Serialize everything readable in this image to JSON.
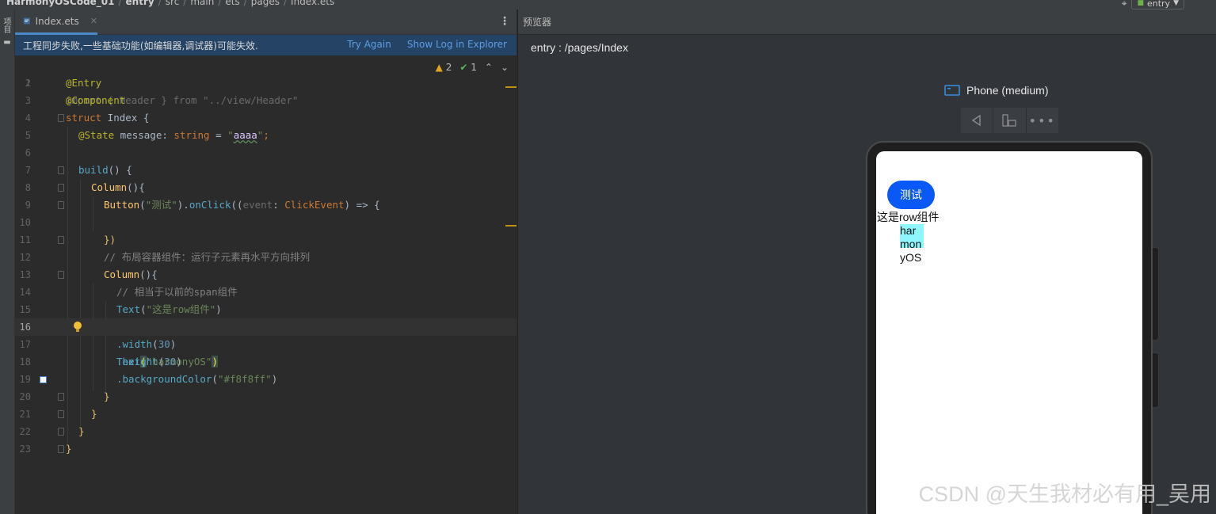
{
  "topbar": {
    "project": "HarmonyOSCode_01",
    "module": "entry",
    "path": [
      "src",
      "main",
      "ets",
      "pages"
    ],
    "file": "Index.ets",
    "run_config": "entry"
  },
  "left_strip": {
    "label": "项目"
  },
  "editor": {
    "tab_label": "Index.ets",
    "notice": {
      "message": "工程同步失败,一些基础功能(如编辑器,调试器)可能失效.",
      "try_again": "Try Again",
      "show_log": "Show Log in Explorer"
    },
    "inspection": {
      "warnings": "2",
      "weak_warnings": "1"
    },
    "current_line": 16,
    "lines": [
      {
        "n": "1"
      },
      {
        "n": "2"
      },
      {
        "n": "3"
      },
      {
        "n": "4"
      },
      {
        "n": "5"
      },
      {
        "n": "6"
      },
      {
        "n": "7"
      },
      {
        "n": "8"
      },
      {
        "n": "9"
      },
      {
        "n": "10"
      },
      {
        "n": "11"
      },
      {
        "n": "12"
      },
      {
        "n": "13"
      },
      {
        "n": "14"
      },
      {
        "n": "15"
      },
      {
        "n": "16"
      },
      {
        "n": "17"
      },
      {
        "n": "18"
      },
      {
        "n": "19"
      },
      {
        "n": "20"
      },
      {
        "n": "21"
      },
      {
        "n": "22"
      },
      {
        "n": "23"
      }
    ],
    "code": {
      "l1": [
        "import",
        " { ",
        "Header",
        " } ",
        "from",
        " \"../view/Header\""
      ],
      "l2": "@Entry",
      "l3": "@Component",
      "l4": [
        "struct",
        " Index {"
      ],
      "l5": [
        "@State",
        " message: ",
        "string",
        " = ",
        "\"",
        "aaaa",
        "\"",
        ";"
      ],
      "l7": [
        "build",
        "() {"
      ],
      "l8": [
        "Column",
        "(){"
      ],
      "l9": [
        "Button",
        "(",
        "\"测试\"",
        ").",
        "onClick",
        "((",
        "event",
        ": ",
        "ClickEvent",
        ") => {"
      ],
      "l11": "})",
      "l12": "// 布局容器组件：运行子元素再水平方向排列",
      "l13": [
        "Column",
        "(){"
      ],
      "l14": "// 相当于以前的span组件",
      "l15": [
        "Text",
        "(",
        "\"这是row组件\"",
        ")"
      ],
      "l16": [
        "Text",
        "(",
        "\"harmonyOS\"",
        ")"
      ],
      "l17": [
        ".width",
        "(",
        "30",
        ")"
      ],
      "l18": [
        ".height",
        "(",
        "30",
        ")"
      ],
      "l19": [
        ".backgroundColor",
        "(",
        "\"#f8f8ff\"",
        ")"
      ],
      "l20": "}",
      "l21": "}",
      "l22": "}",
      "l23": "}"
    }
  },
  "previewer": {
    "header": "预览器",
    "route": "entry : /pages/Index",
    "device": "Phone (medium)",
    "app": {
      "button_label": "测试",
      "text_row": "这是row组件",
      "text_harmony": "harmonyOS",
      "text_bg_color": "#f8f8ff"
    }
  },
  "watermark": "CSDN @天生我材必有用_吴用",
  "colors": {
    "accent": "#4a88c7",
    "notice_bg": "#254364",
    "link": "#5d9ee6",
    "app_button": "#0a59f7"
  }
}
